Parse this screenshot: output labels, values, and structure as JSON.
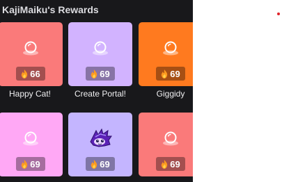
{
  "panel": {
    "title": "KajiMaiku's Rewards"
  },
  "rewards": [
    {
      "label": "Happy Cat!",
      "cost": "66",
      "color": "#fa7a7a",
      "icon": "orb-icon"
    },
    {
      "label": "Create Portal!",
      "cost": "69",
      "color": "#d2b3ff",
      "icon": "orb-icon"
    },
    {
      "label": "Giggidy",
      "cost": "69",
      "color": "#ff7a1f",
      "icon": "orb-icon"
    },
    {
      "label": "",
      "cost": "69",
      "color": "#ffa8f5",
      "icon": "orb-icon"
    },
    {
      "label": "",
      "cost": "69",
      "color": "#c4b5ff",
      "icon": "purple-creature-icon"
    },
    {
      "label": "",
      "cost": "69",
      "color": "#fa7a7a",
      "icon": "orb-icon"
    }
  ],
  "notification_dot_color": "#e0242b"
}
